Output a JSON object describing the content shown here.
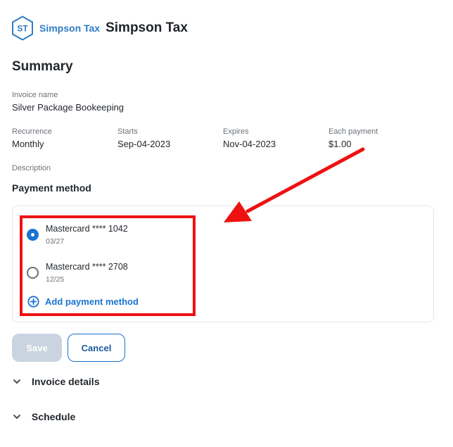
{
  "header": {
    "logo_initials": "ST",
    "logo_text": "Simpson Tax",
    "company_title": "Simpson Tax"
  },
  "summary": {
    "title": "Summary",
    "invoice_name_label": "Invoice name",
    "invoice_name": "Silver Package Bookeeping",
    "recurrence_label": "Recurrence",
    "recurrence": "Monthly",
    "starts_label": "Starts",
    "starts": "Sep-04-2023",
    "expires_label": "Expires",
    "expires": "Nov-04-2023",
    "each_payment_label": "Each payment",
    "each_payment": "$1.00",
    "description_label": "Description"
  },
  "payment_method": {
    "heading": "Payment method",
    "options": [
      {
        "name": "Mastercard **** 1042",
        "expiry": "03/27",
        "selected": true
      },
      {
        "name": "Mastercard **** 2708",
        "expiry": "12/25",
        "selected": false
      }
    ],
    "add_label": "Add payment method"
  },
  "actions": {
    "save_label": "Save",
    "cancel_label": "Cancel"
  },
  "accordions": [
    {
      "label": "Invoice details"
    },
    {
      "label": "Schedule"
    }
  ],
  "colors": {
    "brand": "#2f7cc4",
    "accent": "#1a73d1",
    "annotation": "#ee1111",
    "disabled_button": "#c9d4e0"
  },
  "icons": {
    "logo": "hexagon-logo-icon",
    "radio_selected": "radio-checked-icon",
    "radio_unselected": "radio-unchecked-icon",
    "add": "plus-circle-icon",
    "chevron": "chevron-down-icon"
  }
}
